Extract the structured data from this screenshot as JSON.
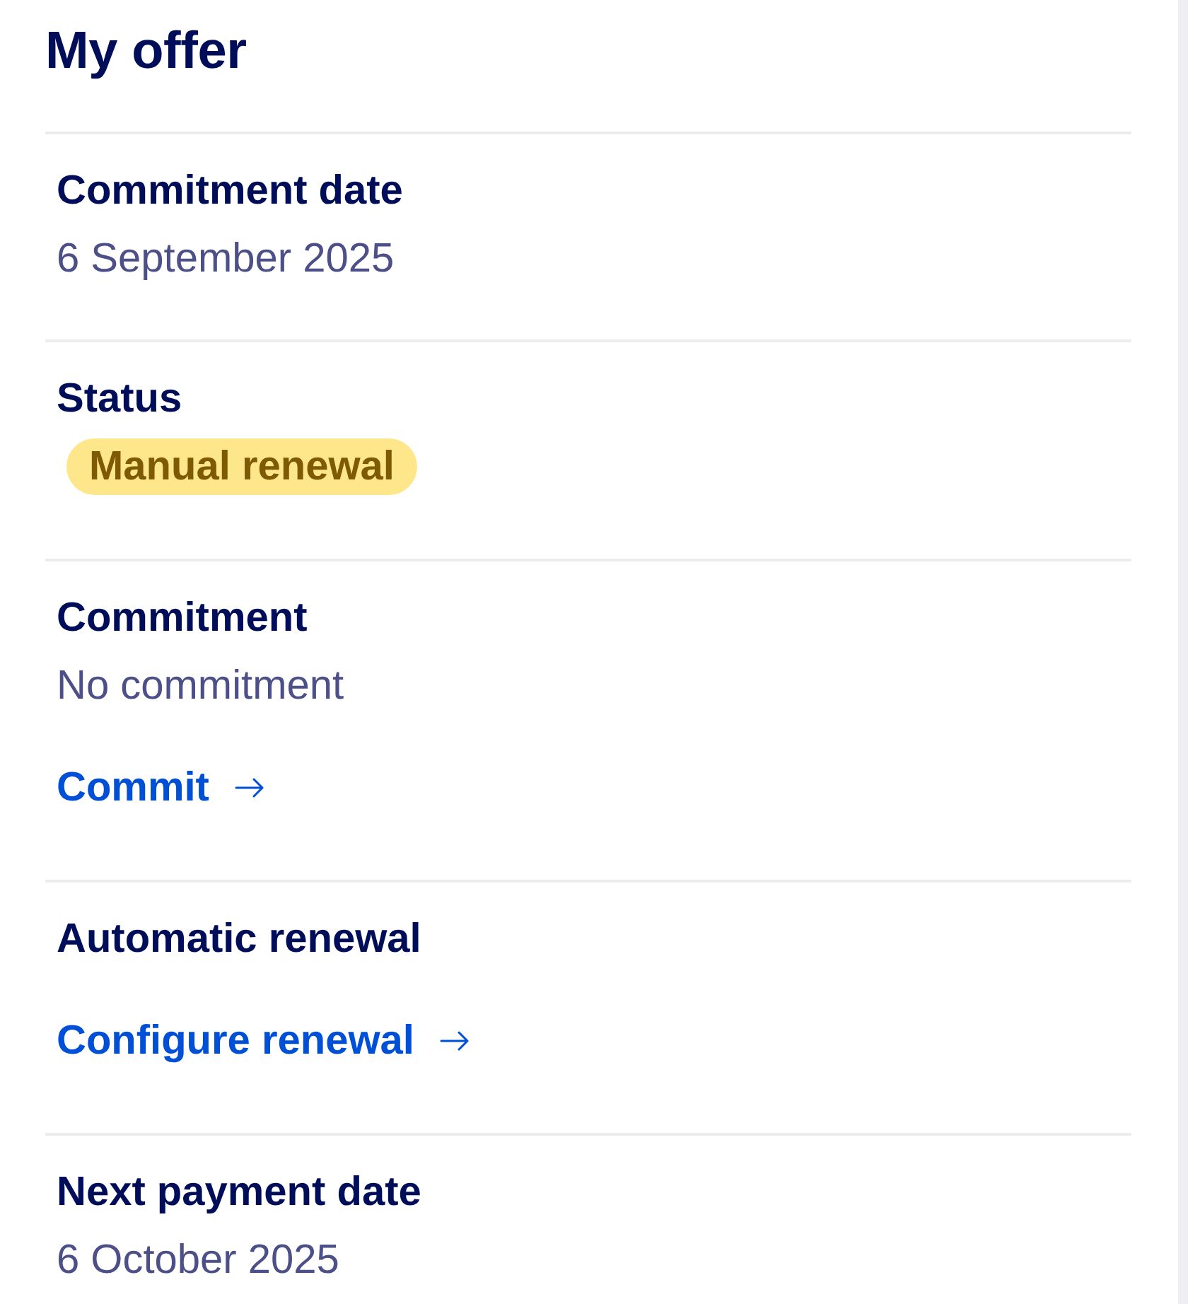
{
  "title": "My offer",
  "sections": [
    {
      "label": "Commitment date",
      "items": [
        {
          "kind": "value",
          "text": "6 September 2025"
        }
      ]
    },
    {
      "label": "Status",
      "items": [
        {
          "kind": "badge",
          "text": "Manual renewal"
        }
      ]
    },
    {
      "label": "Commitment",
      "items": [
        {
          "kind": "value",
          "text": "No commitment"
        },
        {
          "kind": "link",
          "text": "Commit"
        }
      ]
    },
    {
      "label": "Automatic renewal",
      "items": [
        {
          "kind": "link",
          "text": "Configure renewal"
        }
      ]
    },
    {
      "label": "Next payment date",
      "items": [
        {
          "kind": "value",
          "text": "6 October 2025"
        }
      ]
    }
  ]
}
